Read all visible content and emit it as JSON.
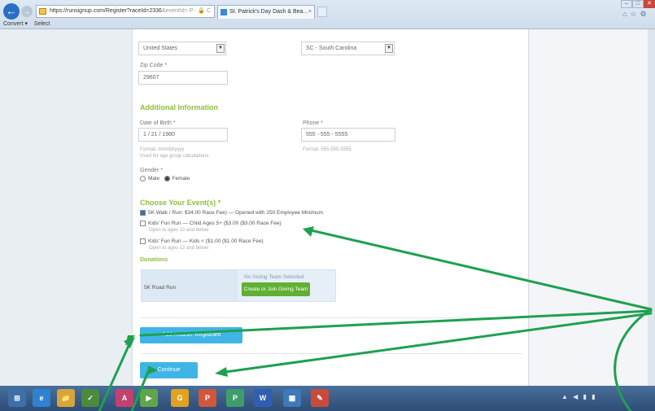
{
  "browser": {
    "url": "https://runsignup.com/Register?raceId=2336",
    "url_tail": "&eventId= P - 🔒 C",
    "tab_title": "St. Patrick's Day Dash & Bea...",
    "tab_close": "×",
    "menu": [
      "Convert ▾",
      "Select"
    ]
  },
  "form": {
    "country_value": "United States",
    "state_value": "SC - South Carolina",
    "zip_label": "Zip Code *",
    "zip_value": "29607",
    "additional_title": "Additional Information",
    "dob_label": "Date of Birth *",
    "dob_value": "1 / 21 / 1980",
    "dob_hint1": "Format: mm/dd/yyyy",
    "dob_hint2": "Used for age group calculations",
    "phone_label": "Phone *",
    "phone_value": "555 - 555 - 5555",
    "phone_hint": "Format: 555-555-5555",
    "gender_label": "Gender *",
    "gender_male": "Male",
    "gender_female": "Female",
    "events_title": "Choose Your Event(s) *",
    "events": [
      {
        "label": "5K Walk / Run: $34.00 Race Fee) — Opened with 250 Employee Minimum",
        "checked": true
      },
      {
        "label": "Kids' Fun Run — Child Ages 5+ ($3.00 ($3.00 Race Fee)",
        "checked": false,
        "sub": "Open to ages 12 and below"
      },
      {
        "label": "Kids' Fun Run — Kids < ($1.00 ($1.00 Race Fee)",
        "checked": false,
        "sub": "Open to ages 12 and below"
      }
    ],
    "donation_title": "Donations",
    "donation_event": "5K Road Run",
    "donation_note": "No Giving Team Selected",
    "donation_button": "Create or Join Giving Team"
  },
  "actions": {
    "add_another": "Add Another Registrant",
    "continue": "Continue"
  },
  "taskbar": {
    "apps": [
      "⊞",
      "e",
      "📁",
      "✓",
      "A",
      "▶",
      "G",
      "P",
      "P",
      "W",
      "▦",
      "✎"
    ],
    "tray": "▲ ◀ ▮ ▮"
  },
  "colors": {
    "annotation": "#1fa050",
    "accent_blue": "#3fb5e5",
    "section_green": "#8bbf3f",
    "donation_green": "#5fb033"
  }
}
